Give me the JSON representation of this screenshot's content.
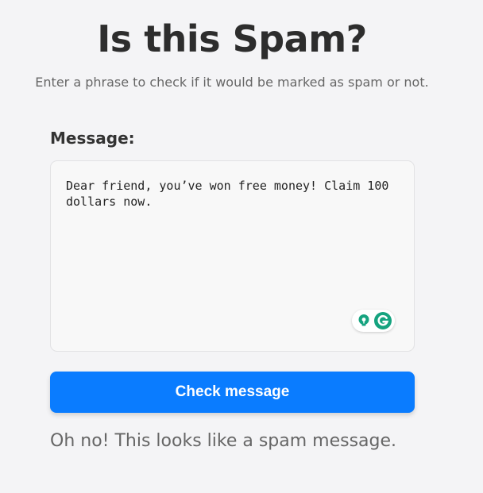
{
  "header": {
    "title": "Is this Spam?",
    "subtitle": "Enter a phrase to check if it would be marked as spam or not."
  },
  "form": {
    "message_label": "Message:",
    "message_value": "Dear friend, you’ve won free money! Claim 100 dollars now.",
    "button_label": "Check message"
  },
  "result": {
    "text": "Oh no! This looks like a spam message."
  },
  "icons": {
    "suggestion": "lightbulb-icon",
    "grammarly": "grammarly-g-icon"
  },
  "colors": {
    "button": "#0a7cff",
    "grammarly_green": "#15a37f"
  }
}
